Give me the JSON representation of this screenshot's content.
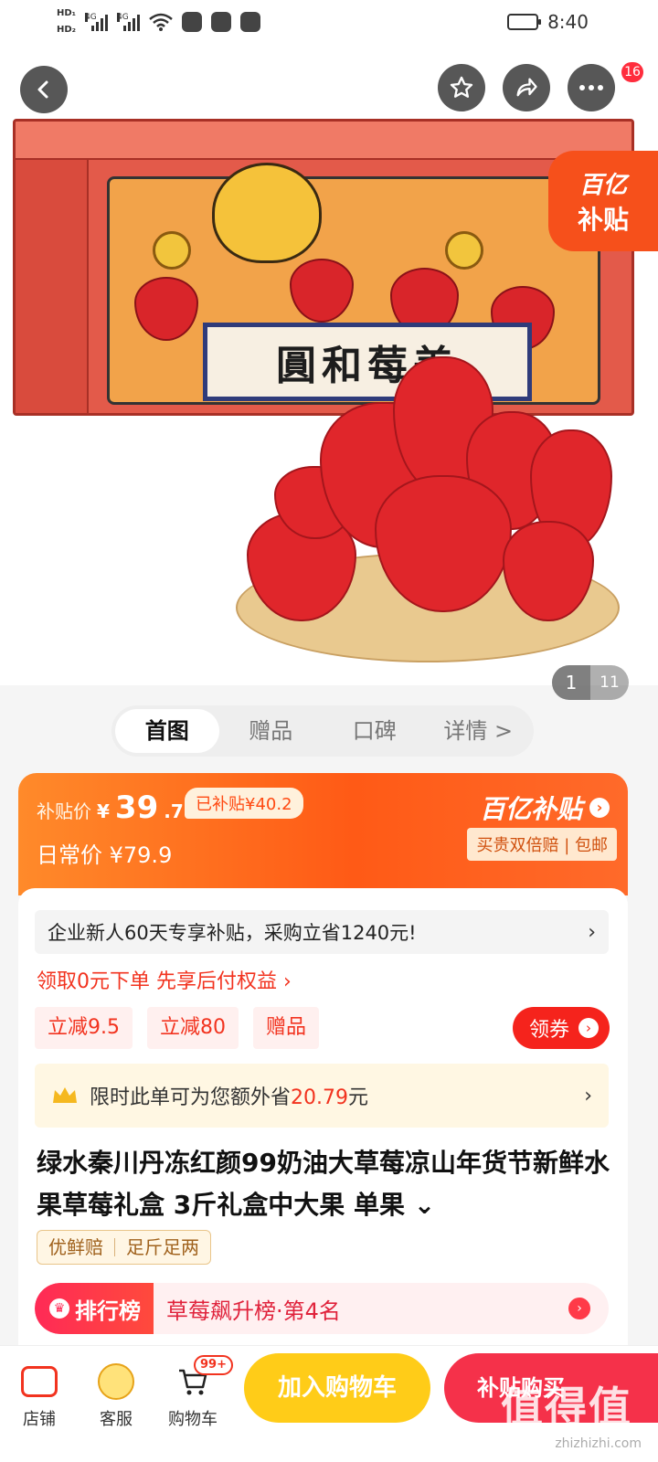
{
  "status_bar": {
    "sim1": "HD₁",
    "sim2": "HD₂",
    "net1": "4G",
    "net2": "4G",
    "time": "8:40"
  },
  "nav": {
    "back_icon": "chevron-left",
    "favorite_icon": "star",
    "share_icon": "share-arrow",
    "more_icon": "ellipsis",
    "more_badge": "16"
  },
  "gallery": {
    "box_title": "圓和莓美",
    "subsidy_flag_line1": "百亿",
    "subsidy_flag_line2": "补贴",
    "current": "1",
    "total": "11"
  },
  "tabs": [
    {
      "label": "首图",
      "active": true
    },
    {
      "label": "赠品",
      "active": false
    },
    {
      "label": "口碑",
      "active": false
    },
    {
      "label": "详情 >",
      "active": false
    }
  ],
  "price": {
    "subsidy_label": "补贴价",
    "currency": "¥",
    "price_int": "39",
    "price_dec": ".7",
    "subsidized_chip": "已补贴¥40.2",
    "daily_label": "日常价 ¥79.9",
    "program_logo": "百亿补贴",
    "guarantee": "买贵双倍赔 | 包邮"
  },
  "promo": {
    "enterprise_text": "企业新人60天专享补贴，采购立省1240元!",
    "pay_later": "领取0元下单 先享后付权益 ›",
    "chips": [
      "立减9.5",
      "立减80",
      "赠品"
    ],
    "coupon_button": "领券",
    "save_prefix": "限时此单可为您额外省",
    "save_amount": "20.79",
    "save_suffix": "元"
  },
  "product": {
    "title": "绿水秦川丹冻红颜99奶油大草莓凉山年货节新鲜水果草莓礼盒 3斤礼盒中大果 单果 ⌄",
    "tags": [
      "优鲜赔",
      "足斤足两"
    ],
    "rank_label": "排行榜",
    "rank_text": "草莓飙升榜·第4名"
  },
  "bottom_bar": {
    "store_label": "店铺",
    "service_label": "客服",
    "cart_label": "购物车",
    "cart_badge": "99+",
    "add_to_cart": "加入购物车",
    "buy_now": "补贴购买"
  },
  "watermark": {
    "text": "值得值",
    "url": "zhizhizhi.com"
  },
  "colors": {
    "accent_red": "#f2331f",
    "subsidy_orange": "#ff5a16",
    "cart_yellow": "#ffcc18",
    "buy_red": "#f5314a"
  }
}
